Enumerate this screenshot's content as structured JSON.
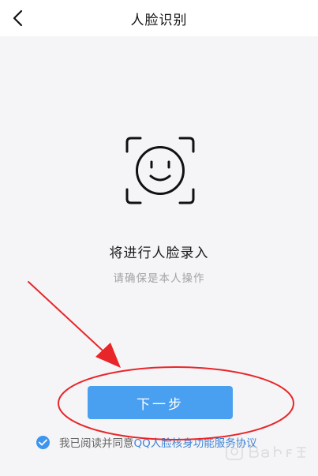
{
  "navbar": {
    "title": "人脸识别",
    "back_icon": "chevron-left-icon"
  },
  "face": {
    "icon": "face-scan-icon"
  },
  "prompt": {
    "main": "将进行人脸录入",
    "sub": "请确保是本人操作"
  },
  "actions": {
    "next_label": "下一步"
  },
  "agreement": {
    "checked": true,
    "prefix": "我已阅读并同意",
    "link": "QQ人脸核身功能服务协议"
  },
  "colors": {
    "primary": "#4aa0f0",
    "check": "#3d95ee",
    "link": "#3d83d6",
    "annotation": "#e8262a"
  }
}
